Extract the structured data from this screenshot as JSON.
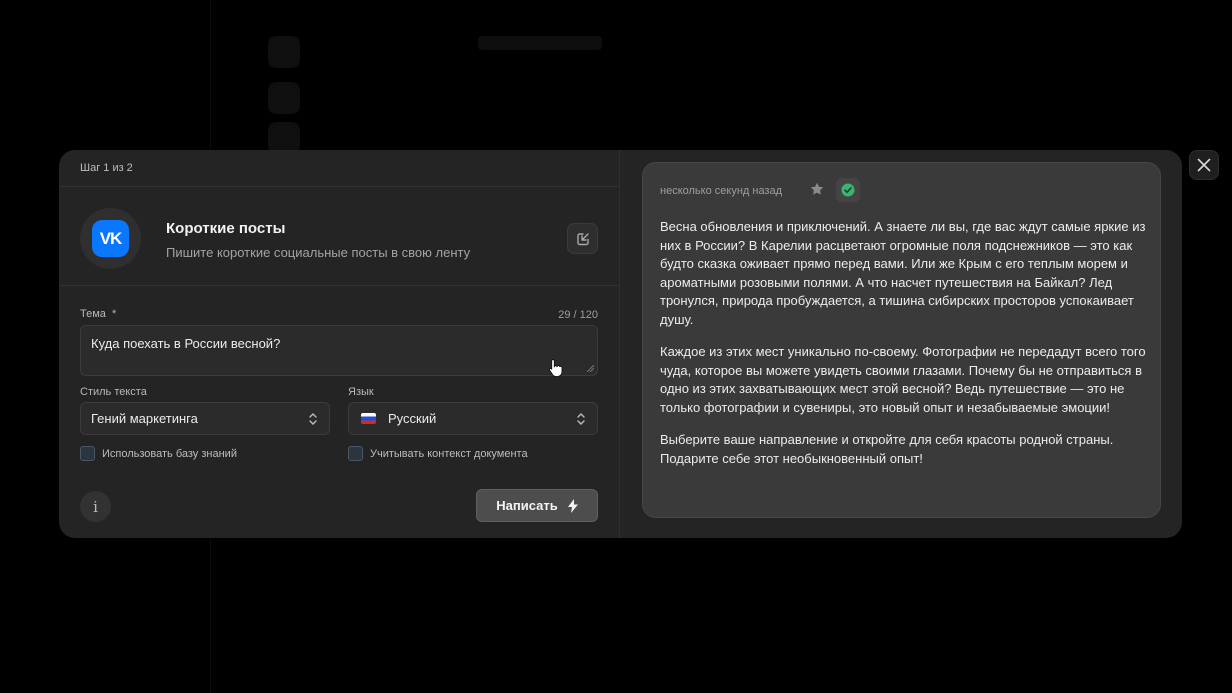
{
  "modal": {
    "step": "Шаг 1 из 2",
    "app": {
      "logo_text": "VK",
      "title": "Короткие посты",
      "subtitle": "Пишите короткие социальные посты в свою ленту",
      "open_icon": "external-link-icon"
    },
    "form": {
      "topic_label": "Тема",
      "required_mark": "*",
      "topic_counter": "29 / 120",
      "topic_value": "Куда поехать в России весной?",
      "style_label": "Стиль текста",
      "style_value": "Гений маркетинга",
      "language_label": "Язык",
      "language_value": "Русский",
      "use_knowledge_label": "Использовать базу знаний",
      "use_context_label": "Учитывать контекст документа",
      "info_label": "i",
      "write_button": "Написать"
    },
    "result": {
      "timestamp": "несколько секунд назад",
      "paragraphs": [
        "Весна обновления и приключений. А знаете ли вы, где вас ждут самые яркие из них в России? В Карелии расцветают огромные поля подснежников — это как будто сказка оживает прямо перед вами. Или же Крым с его теплым морем и ароматными розовыми полями. А что насчет путешествия на Байкал? Лед тронулся, природа пробуждается, а тишина сибирских просторов успокаивает душу.",
        "Каждое из этих мест уникально по-своему. Фотографии не передадут всего того чуда, которое вы можете увидеть своими глазами. Почему бы не отправиться в одно из этих захватывающих мест этой весной? Ведь путешествие — это не только фотографии и сувениры, это новый опыт и незабываемые эмоции!",
        "Выберите ваше направление и откройте для себя красоты родной страны. Подарите себе этот необыкновенный опыт!"
      ]
    }
  },
  "colors": {
    "accent_vk": "#0b77ff",
    "success": "#3cb371",
    "modal_bg": "#242424",
    "card_bg": "#3a3a3a"
  }
}
